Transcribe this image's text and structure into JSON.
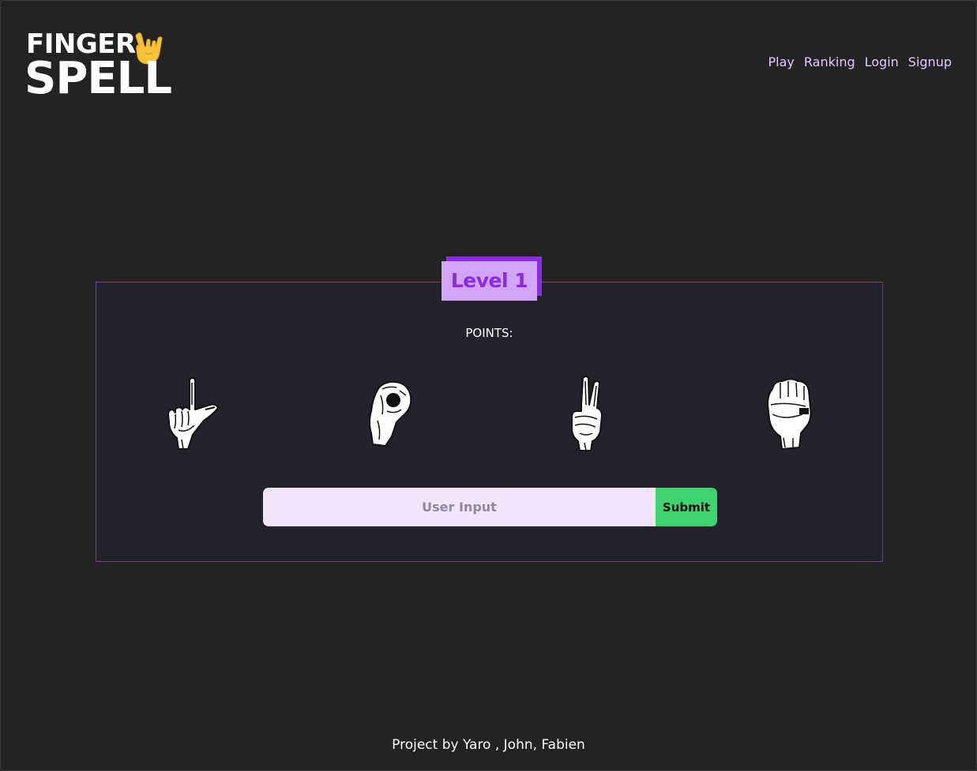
{
  "logo": {
    "line1": "FINGER",
    "line2": "SPELL",
    "hand_icon": "rock-hand-icon",
    "hand_color": "#f7c23c"
  },
  "nav": {
    "items": [
      {
        "label": "Play"
      },
      {
        "label": "Ranking"
      },
      {
        "label": "Login"
      },
      {
        "label": "Signup"
      }
    ]
  },
  "game": {
    "level_label": "Level 1",
    "points_label": "POINTS:",
    "signs": [
      {
        "icon": "sign-hand-l-icon"
      },
      {
        "icon": "sign-hand-o-icon"
      },
      {
        "icon": "sign-hand-v-icon"
      },
      {
        "icon": "sign-hand-e-icon"
      }
    ],
    "input": {
      "value": "",
      "placeholder": "User Input"
    },
    "submit_label": "Submit"
  },
  "footer": {
    "credit": "Project by Yaro , John, Fabien"
  },
  "colors": {
    "background": "#232323",
    "accent_purple": "#8a2be2",
    "badge_fill": "#d1a4f7",
    "nav_text": "#e2c8ff",
    "submit_green": "#3ed36e",
    "input_fill": "#f3e4fd"
  }
}
